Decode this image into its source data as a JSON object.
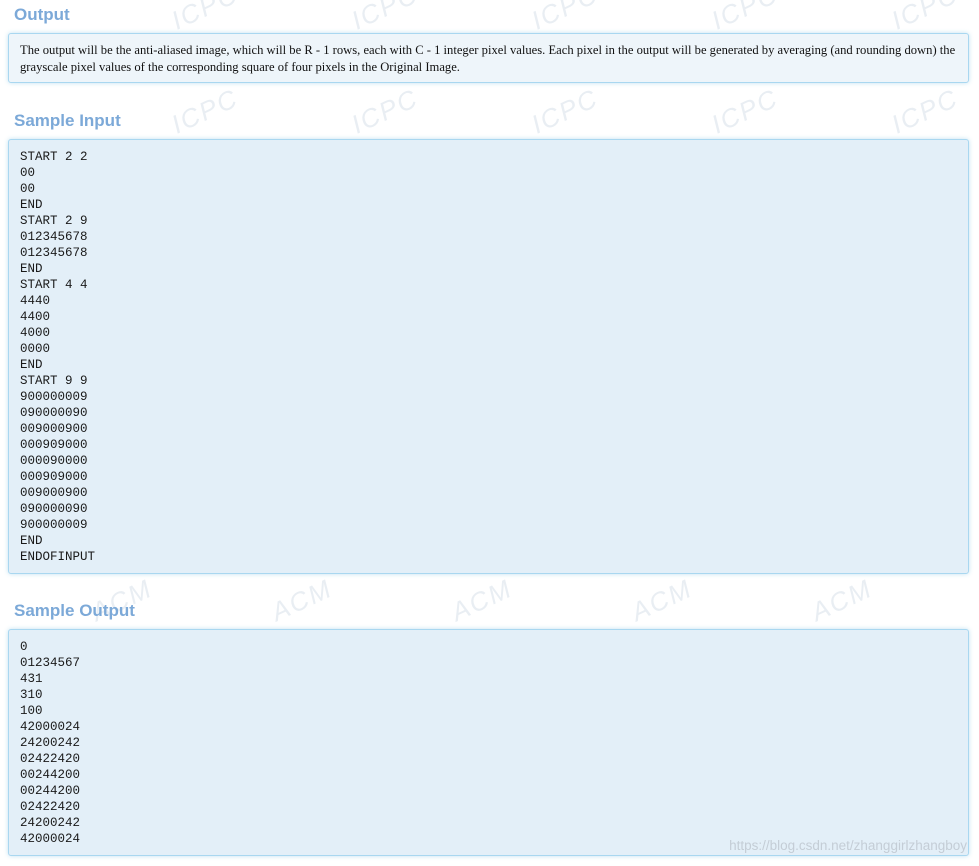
{
  "watermarks": {
    "icpc": "ICPC",
    "acm": "ACM"
  },
  "output_section": {
    "title": "Output",
    "description": "The output will be the anti-aliased image, which will be R - 1 rows, each with C - 1 integer pixel values. Each pixel in the output will be generated by averaging (and rounding down) the grayscale pixel values of the corresponding square of four pixels in the Original Image."
  },
  "sample_input": {
    "title": "Sample Input",
    "lines": [
      "START 2 2",
      "00",
      "00",
      "END",
      "START 2 9",
      "012345678",
      "012345678",
      "END",
      "START 4 4",
      "4440",
      "4400",
      "4000",
      "0000",
      "END",
      "START 9 9",
      "900000009",
      "090000090",
      "009000900",
      "000909000",
      "000090000",
      "000909000",
      "009000900",
      "090000090",
      "900000009",
      "END",
      "ENDOFINPUT"
    ]
  },
  "sample_output": {
    "title": "Sample Output",
    "lines": [
      "0",
      "01234567",
      "431",
      "310",
      "100",
      "42000024",
      "24200242",
      "02422420",
      "00244200",
      "00244200",
      "02422420",
      "24200242",
      "42000024"
    ]
  },
  "credit": "https://blog.csdn.net/zhanggirlzhangboy",
  "colors": {
    "heading": "#7ca9d8",
    "panel_border": "#a9d7f0",
    "panel_bg": "#e3eff8"
  }
}
